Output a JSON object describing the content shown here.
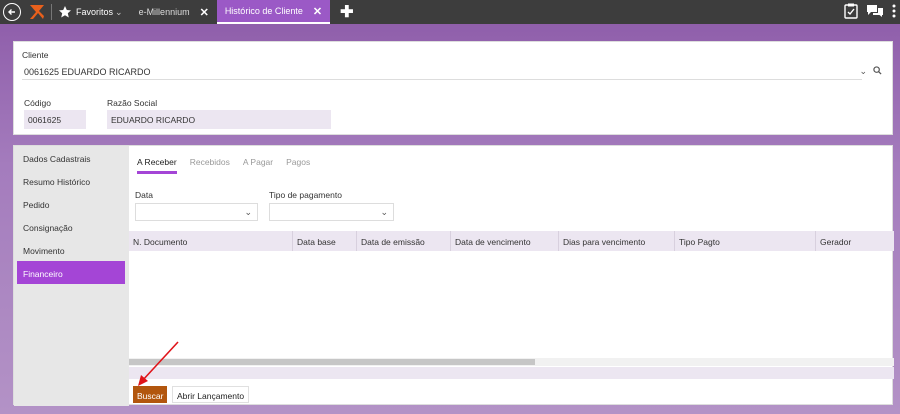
{
  "topbar": {
    "favoritos_label": "Favoritos",
    "tabs": [
      {
        "label": "e-Millennium"
      },
      {
        "label": "Histórico de Cliente"
      }
    ]
  },
  "client": {
    "cliente_label": "Cliente",
    "cliente_value": "0061625 EDUARDO RICARDO",
    "codigo_label": "Código",
    "codigo_value": "0061625",
    "razao_label": "Razão Social",
    "razao_value": "EDUARDO RICARDO"
  },
  "sidebar": {
    "items": [
      {
        "label": "Dados Cadastrais"
      },
      {
        "label": "Resumo Histórico"
      },
      {
        "label": "Pedido"
      },
      {
        "label": "Consignação"
      },
      {
        "label": "Movimento"
      },
      {
        "label": "Financeiro"
      }
    ]
  },
  "subtabs": [
    {
      "label": "A Receber"
    },
    {
      "label": "Recebidos"
    },
    {
      "label": "A Pagar"
    },
    {
      "label": "Pagos"
    }
  ],
  "filters": {
    "data_label": "Data",
    "tipo_label": "Tipo de pagamento"
  },
  "grid": {
    "columns": [
      "N. Documento",
      "Data base",
      "Data de emissão",
      "Data de vencimento",
      "Dias para vencimento",
      "Tipo Pagto",
      "Gerador"
    ]
  },
  "actions": {
    "buscar": "Buscar",
    "abrir": "Abrir Lançamento"
  },
  "colors": {
    "accent": "#a445d6",
    "buscar": "#b2560e"
  }
}
